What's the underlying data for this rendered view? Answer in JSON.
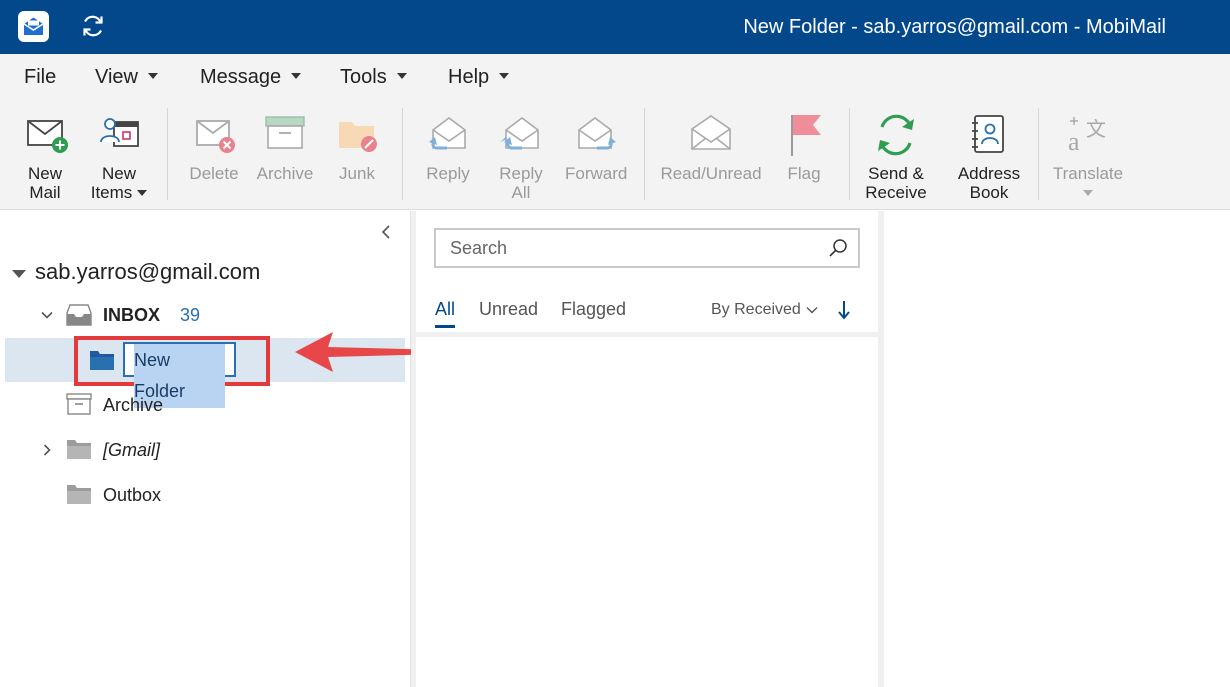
{
  "window": {
    "title": "New Folder - sab.yarros@gmail.com - MobiMail",
    "icons": {
      "logo": "mobimail-logo-icon",
      "sync": "sync-icon"
    }
  },
  "menu": {
    "items": [
      {
        "label": "File",
        "has_dropdown": false
      },
      {
        "label": "View",
        "has_dropdown": true
      },
      {
        "label": "Message",
        "has_dropdown": true
      },
      {
        "label": "Tools",
        "has_dropdown": true
      },
      {
        "label": "Help",
        "has_dropdown": true
      }
    ]
  },
  "ribbon": {
    "new_mail": {
      "label_line1": "New",
      "label_line2": "Mail",
      "icon": "new-mail-icon",
      "enabled": true
    },
    "new_items": {
      "label_line1": "New",
      "label_line2": "Items",
      "icon": "new-items-icon",
      "enabled": true,
      "has_dropdown": true
    },
    "delete": {
      "label": "Delete",
      "icon": "delete-icon",
      "enabled": false
    },
    "archive": {
      "label": "Archive",
      "icon": "archive-icon",
      "enabled": false
    },
    "junk": {
      "label": "Junk",
      "icon": "junk-icon",
      "enabled": false
    },
    "reply": {
      "label": "Reply",
      "icon": "reply-icon",
      "enabled": false
    },
    "reply_all": {
      "label_line1": "Reply",
      "label_line2": "All",
      "icon": "reply-all-icon",
      "enabled": false
    },
    "forward": {
      "label": "Forward",
      "icon": "forward-icon",
      "enabled": false
    },
    "read_unread": {
      "label": "Read/Unread",
      "icon": "read-unread-icon",
      "enabled": false
    },
    "flag": {
      "label": "Flag",
      "icon": "flag-icon",
      "enabled": false
    },
    "send_receive": {
      "label_line1": "Send &",
      "label_line2": "Receive",
      "icon": "send-receive-icon",
      "enabled": true
    },
    "address_book": {
      "label_line1": "Address",
      "label_line2": "Book",
      "icon": "address-book-icon",
      "enabled": true
    },
    "translate": {
      "label": "Translate",
      "icon": "translate-icon",
      "enabled": false,
      "has_dropdown": true
    }
  },
  "folders": {
    "account": "sab.yarros@gmail.com",
    "inbox": {
      "label": "INBOX",
      "count": "39"
    },
    "renaming": {
      "value": "New Folder"
    },
    "archive": {
      "label": "Archive"
    },
    "gmail": {
      "label": "[Gmail]"
    },
    "outbox": {
      "label": "Outbox"
    }
  },
  "message_list": {
    "search_placeholder": "Search",
    "tabs": [
      {
        "label": "All",
        "active": true
      },
      {
        "label": "Unread",
        "active": false
      },
      {
        "label": "Flagged",
        "active": false
      }
    ],
    "sort_label": "By Received"
  },
  "colors": {
    "titlebar": "#04488c",
    "accent": "#2a6fb0",
    "annotation": "#e23a3a",
    "selection": "#dce6f0"
  }
}
